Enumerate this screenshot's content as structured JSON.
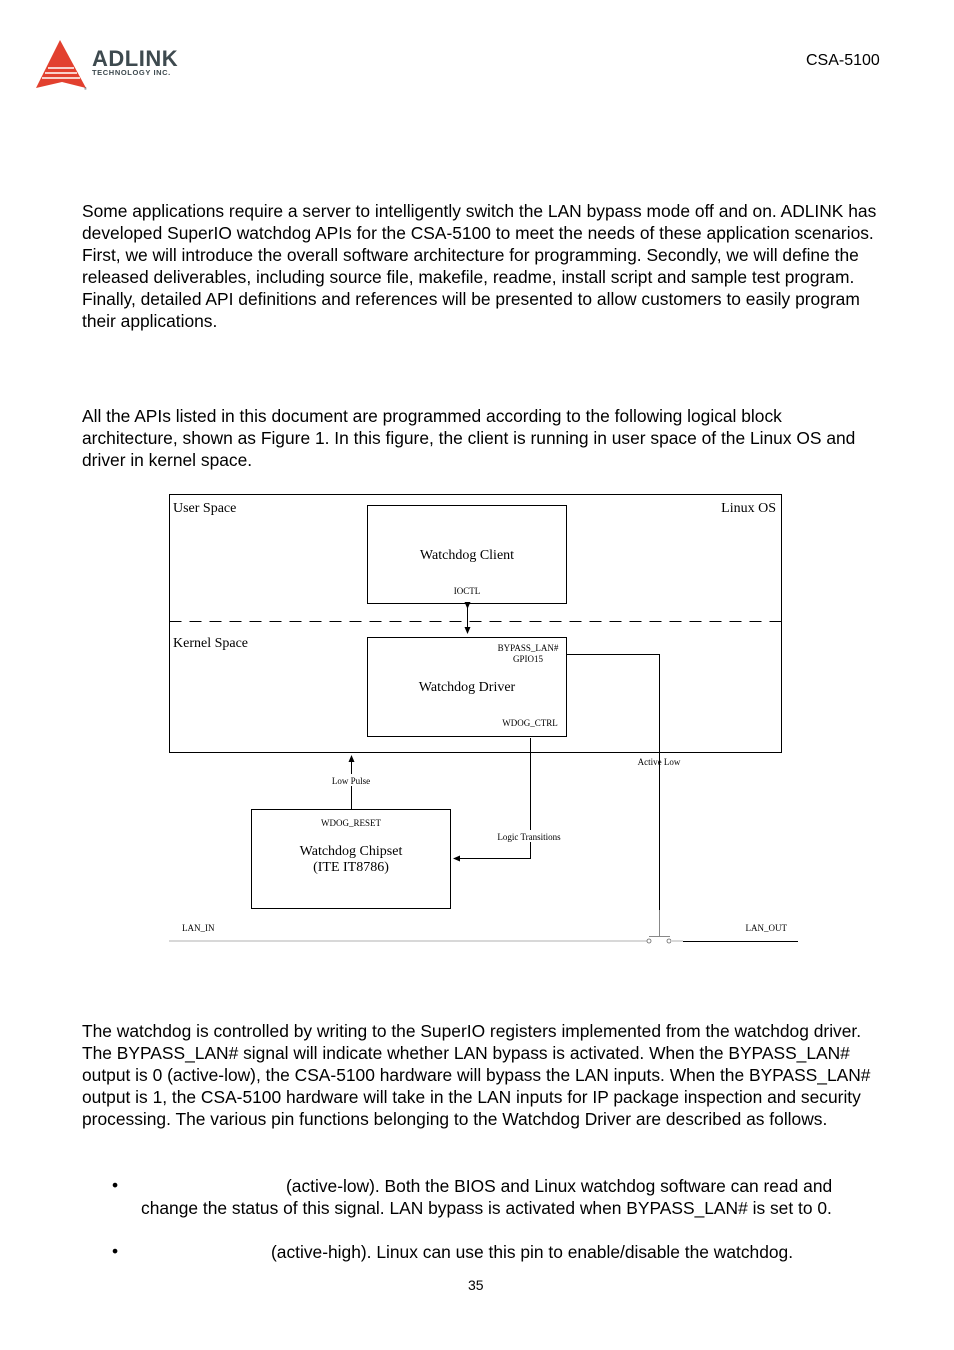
{
  "header": {
    "brand_name": "ADLINK",
    "brand_subtitle": "TECHNOLOGY INC.",
    "brand_color": "#e2402f",
    "document_model": "CSA-5100"
  },
  "body": {
    "intro_paragraph": "Some applications require a server to intelligently switch the LAN bypass mode off and on. ADLINK has developed SuperIO watchdog APIs for the CSA-5100 to meet the needs of these application scenarios. First, we will introduce the overall software architecture for programming. Secondly, we will define the released deliverables, including source file, makefile, readme, install script and sample test program. Finally, detailed API definitions and references will be presented to allow customers to easily program their applications.",
    "architecture_paragraph": "All the APIs listed in this document are programmed according to the following logical block architecture, shown as Figure 1. In this figure, the client is running in user space of the Linux OS and driver in kernel space.",
    "watchdog_paragraph": "The watchdog is controlled by writing to the SuperIO registers implemented from the watchdog driver. The BYPASS_LAN# signal will indicate whether LAN bypass is activated. When the BYPASS_LAN# output is 0 (active-low), the CSA-5100 hardware will bypass the LAN inputs. When the BYPASS_LAN# output is 1, the CSA-5100 hardware will take in the LAN inputs for IP package inspection and security processing. The various pin functions belonging to the Watchdog Driver are described as follows.",
    "bullets": [
      {
        "symbol": "•",
        "text": "(active-low). Both the BIOS and Linux watchdog software can read and change the status of this signal. LAN bypass is activated when BYPASS_LAN# is set to 0."
      },
      {
        "symbol": "•",
        "text": "(active-high). Linux can use this pin to enable/disable the watchdog."
      }
    ]
  },
  "diagram": {
    "user_space_label": "User Space",
    "linux_os_label": "Linux OS",
    "kernel_space_label": "Kernel Space",
    "client_box": {
      "title": "Watchdog Client",
      "port": "IOCTL"
    },
    "driver_box": {
      "title": "Watchdog Driver",
      "port_top_1": "BYPASS_LAN#",
      "port_top_2": "GPIO15",
      "port_bottom": "WDOG_CTRL"
    },
    "chipset_box": {
      "title_1": "Watchdog Chipset",
      "title_2": "(ITE IT8786)",
      "port": "WDOG_RESET"
    },
    "low_pulse_label": "Low Pulse",
    "logic_transitions_label": "Logic Transitions",
    "active_low_label": "Active Low",
    "lan_in_label": "LAN_IN",
    "lan_out_label": "LAN_OUT"
  },
  "footer": {
    "page_number": "35"
  }
}
